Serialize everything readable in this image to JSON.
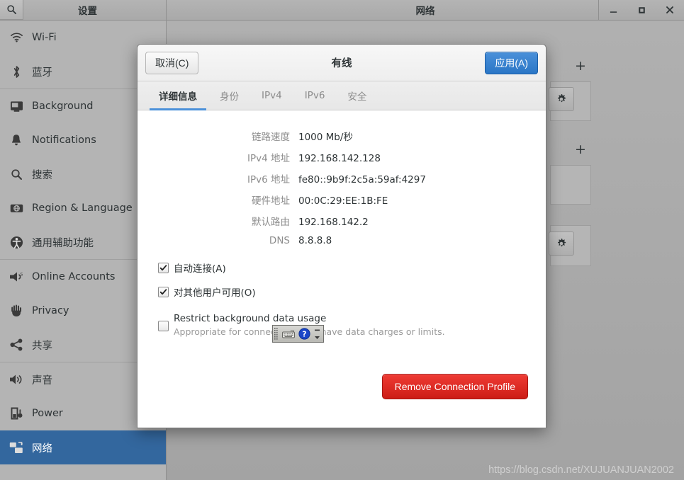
{
  "window": {
    "sidebar_title": "设置",
    "title": "网络",
    "search_icon": "search-icon",
    "controls": {
      "minimize": "—",
      "maximize": "□",
      "close": "✕"
    }
  },
  "sidebar": {
    "items": [
      {
        "label": "Wi-Fi",
        "icon": "wifi-icon",
        "selected": false
      },
      {
        "label": "蓝牙",
        "icon": "bluetooth-icon",
        "selected": false
      },
      {
        "label": "Background",
        "icon": "background-icon",
        "selected": false
      },
      {
        "label": "Notifications",
        "icon": "bell-icon",
        "selected": false
      },
      {
        "label": "搜索",
        "icon": "search-icon",
        "selected": false
      },
      {
        "label": "Region & Language",
        "icon": "region-language-icon",
        "selected": false
      },
      {
        "label": "通用辅助功能",
        "icon": "accessibility-icon",
        "selected": false
      },
      {
        "label": "Online Accounts",
        "icon": "online-accounts-icon",
        "selected": false
      },
      {
        "label": "Privacy",
        "icon": "privacy-hand-icon",
        "selected": false
      },
      {
        "label": "共享",
        "icon": "sharing-icon",
        "selected": false
      },
      {
        "label": "声音",
        "icon": "sound-icon",
        "selected": false
      },
      {
        "label": "Power",
        "icon": "power-battery-icon",
        "selected": false
      },
      {
        "label": "网络",
        "icon": "network-icon",
        "selected": true
      }
    ]
  },
  "content": {
    "add_buttons": [
      "+",
      "+"
    ],
    "gear_icon": "gear-icon"
  },
  "dialog": {
    "title": "有线",
    "cancel_label": "取消(C)",
    "apply_label": "应用(A)",
    "tabs": [
      {
        "label": "详细信息",
        "active": true
      },
      {
        "label": "身份",
        "active": false
      },
      {
        "label": "IPv4",
        "active": false
      },
      {
        "label": "IPv6",
        "active": false
      },
      {
        "label": "安全",
        "active": false
      }
    ],
    "details": [
      {
        "label": "链路速度",
        "value": "1000 Mb/秒"
      },
      {
        "label": "IPv4 地址",
        "value": "192.168.142.128"
      },
      {
        "label": "IPv6 地址",
        "value": "fe80::9b9f:2c5a:59af:4297"
      },
      {
        "label": "硬件地址",
        "value": "00:0C:29:EE:1B:FE"
      },
      {
        "label": "默认路由",
        "value": "192.168.142.2"
      },
      {
        "label": "DNS",
        "value": "8.8.8.8"
      }
    ],
    "checkboxes": [
      {
        "label": "自动连接(A)",
        "checked": true,
        "sub": ""
      },
      {
        "label": "对其他用户可用(O)",
        "checked": true,
        "sub": ""
      },
      {
        "label": "Restrict background data usage",
        "checked": false,
        "sub": "Appropriate for connections that have data charges or limits."
      }
    ],
    "remove_label": "Remove Connection Profile"
  },
  "ibus": {
    "handle_icon": "drag-handle-icon",
    "keyboard_icon": "keyboard-icon",
    "help_icon": "help-question-icon",
    "arrows_icon": "chevron-up-down-icon"
  },
  "watermark": "https://blog.csdn.net/XUJUANJUAN2002",
  "colors": {
    "accent_blue": "#33679e",
    "apply_blue": "#2a76c6",
    "tab_underline": "#4a90d9",
    "danger_red": "#cc1d16",
    "sidebar_bg": "#b4b4b4",
    "dialog_bg": "#ffffff"
  }
}
